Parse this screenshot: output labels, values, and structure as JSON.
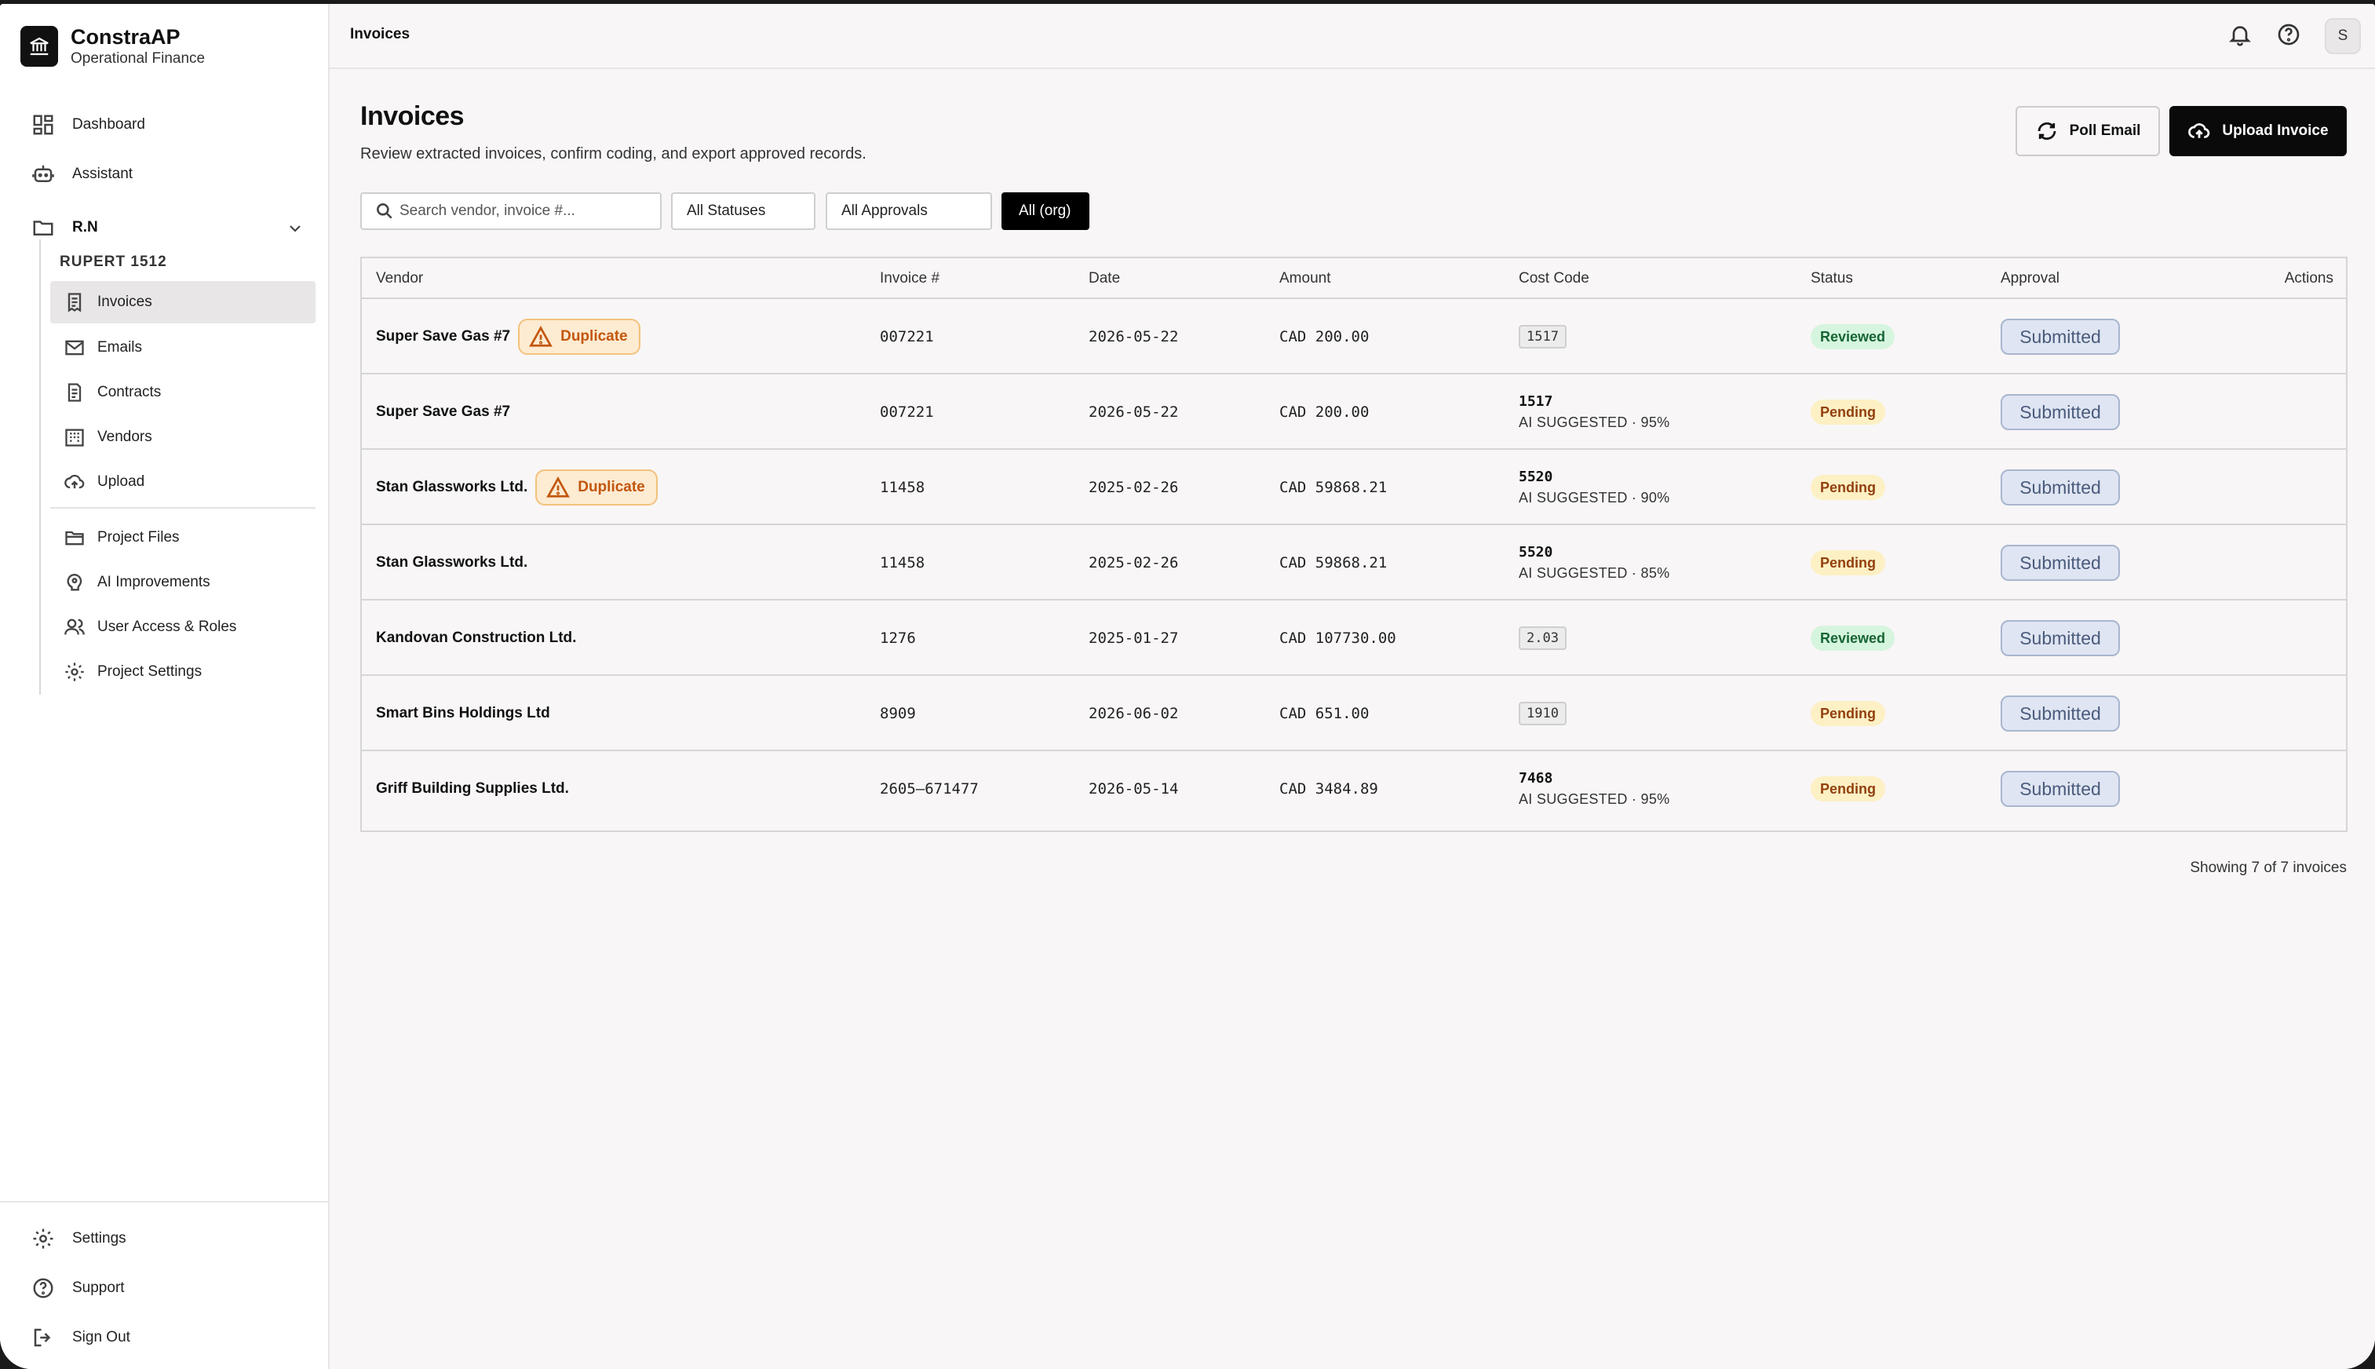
{
  "brand": {
    "title": "ConstraAP",
    "subtitle": "Operational Finance"
  },
  "nav": {
    "dashboard": "Dashboard",
    "assistant": "Assistant"
  },
  "project": {
    "name": "R.N",
    "subtitle": "RUPERT 1512"
  },
  "project_nav": [
    {
      "label": "Invoices",
      "icon": "invoice-icon",
      "active": true
    },
    {
      "label": "Emails",
      "icon": "mail-icon"
    },
    {
      "label": "Contracts",
      "icon": "contract-icon"
    },
    {
      "label": "Vendors",
      "icon": "building-icon"
    },
    {
      "label": "Upload",
      "icon": "cloud-upload-icon"
    },
    {
      "label": "Project Files",
      "icon": "folder-icon"
    },
    {
      "label": "AI Improvements",
      "icon": "ai-icon"
    },
    {
      "label": "User Access & Roles",
      "icon": "users-icon"
    },
    {
      "label": "Project Settings",
      "icon": "gear-icon"
    }
  ],
  "bottom_nav": {
    "settings": "Settings",
    "support": "Support",
    "sign_out": "Sign Out"
  },
  "topbar": {
    "title": "Invoices",
    "avatar": "S"
  },
  "page": {
    "title": "Invoices",
    "description": "Review extracted invoices, confirm coding, and export approved records.",
    "poll_email": "Poll Email",
    "upload_invoice": "Upload Invoice"
  },
  "filters": {
    "search_placeholder": "Search vendor, invoice #...",
    "status": "All Statuses",
    "approvals": "All Approvals",
    "scope": "All (org)"
  },
  "table": {
    "headers": {
      "vendor": "Vendor",
      "invoice": "Invoice #",
      "date": "Date",
      "amount": "Amount",
      "cost_code": "Cost Code",
      "status": "Status",
      "approval": "Approval",
      "actions": "Actions"
    },
    "duplicate_label": "Duplicate",
    "rows": [
      {
        "vendor": "Super Save Gas #7",
        "duplicate": true,
        "invoice": "007221",
        "date": "2026-05-22",
        "amount": "CAD 200.00",
        "cost_code": "1517",
        "suggested": "",
        "status": "Reviewed",
        "approval": "Submitted"
      },
      {
        "vendor": "Super Save Gas #7",
        "duplicate": false,
        "invoice": "007221",
        "date": "2026-05-22",
        "amount": "CAD 200.00",
        "cost_code": "1517",
        "suggested": "AI SUGGESTED · 95%",
        "status": "Pending",
        "approval": "Submitted"
      },
      {
        "vendor": "Stan Glassworks Ltd.",
        "duplicate": true,
        "invoice": "11458",
        "date": "2025-02-26",
        "amount": "CAD 59868.21",
        "cost_code": "5520",
        "suggested": "AI SUGGESTED · 90%",
        "status": "Pending",
        "approval": "Submitted"
      },
      {
        "vendor": "Stan Glassworks Ltd.",
        "duplicate": false,
        "invoice": "11458",
        "date": "2025-02-26",
        "amount": "CAD 59868.21",
        "cost_code": "5520",
        "suggested": "AI SUGGESTED · 85%",
        "status": "Pending",
        "approval": "Submitted"
      },
      {
        "vendor": "Kandovan Construction Ltd.",
        "duplicate": false,
        "invoice": "1276",
        "date": "2025-01-27",
        "amount": "CAD 107730.00",
        "cost_code": "2.03",
        "suggested": "",
        "status": "Reviewed",
        "approval": "Submitted"
      },
      {
        "vendor": "Smart Bins Holdings Ltd",
        "duplicate": false,
        "invoice": "8909",
        "date": "2026-06-02",
        "amount": "CAD 651.00",
        "cost_code": "1910",
        "suggested": "",
        "status": "Pending",
        "approval": "Submitted"
      },
      {
        "vendor": "Griff Building Supplies Ltd.",
        "duplicate": false,
        "invoice": "2605–671477",
        "date": "2026-05-14",
        "amount": "CAD 3484.89",
        "cost_code": "7468",
        "suggested": "AI SUGGESTED · 95%",
        "status": "Pending",
        "approval": "Submitted"
      }
    ]
  },
  "footer": {
    "count": "Showing 7 of 7 invoices"
  },
  "colors": {
    "accent": "#0a0a0a",
    "reviewed": "#d6f5df",
    "pending": "#fdf0c4",
    "duplicate": "#fdebd2"
  }
}
